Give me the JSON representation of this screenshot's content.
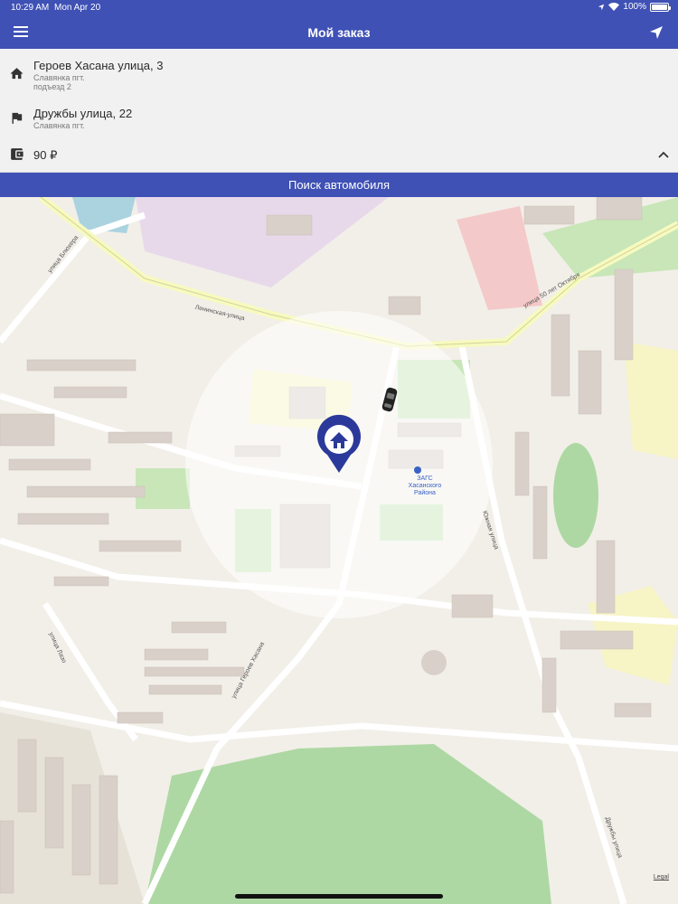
{
  "status_bar": {
    "time": "10:29 AM",
    "date": "Mon Apr 20",
    "battery": "100%",
    "battery_level": 1.0
  },
  "header": {
    "title": "Мой заказ",
    "menu_icon": "hamburger-menu-icon",
    "nav_icon": "navigation-arrow-icon"
  },
  "order": {
    "pickup": {
      "icon": "home-icon",
      "street": "Героев Хасана улица, 3",
      "locality": "Славянка пгт.",
      "entrance": "подъезд 2"
    },
    "destination": {
      "icon": "flag-icon",
      "street": "Дружбы улица, 22",
      "locality": "Славянка пгт."
    },
    "price": {
      "icon": "wallet-icon",
      "value": "90 ₽"
    }
  },
  "search": {
    "label": "Поиск автомобиля"
  },
  "map": {
    "streets": {
      "leninskaya": "Ленинская-улица",
      "blyukhera": "улица Блюхера",
      "geroev_hasana": "улица Героев Хасана",
      "oktyabrya": "улица 50 лет Октября",
      "yuzhnaya": "Южная улица",
      "lazo": "улица Лазо",
      "druzhby": "Дружбы улица"
    },
    "poi": {
      "zags": "ЗАГС\nХасанского\nРайона"
    },
    "legal": "Legal",
    "colors": {
      "park": "#aed8a3",
      "stadium": "#aed8a3",
      "school": "#f7f4c6",
      "industrial": "#e7d9ea",
      "retail": "#f4c9c9",
      "water": "#aad3df",
      "highlight": "#2b3a9a"
    }
  }
}
